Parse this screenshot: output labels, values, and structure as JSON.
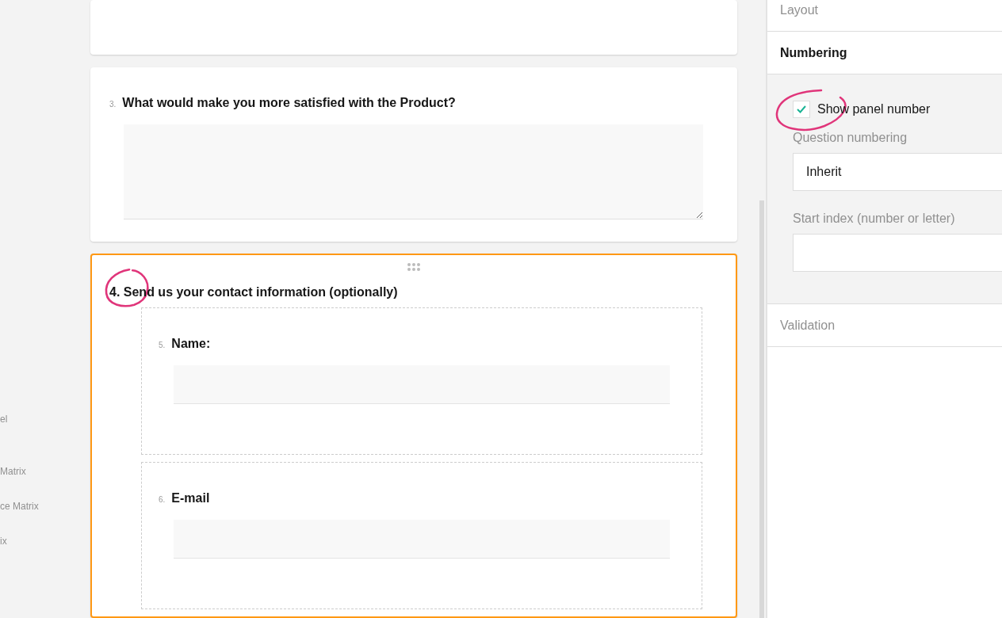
{
  "toolbox": {
    "items": [
      "el",
      "Matrix",
      "ce Matrix",
      "ix"
    ]
  },
  "survey": {
    "question": {
      "number": "3.",
      "title": "What would make you more satisfied with the Product?"
    },
    "panel": {
      "selected": true,
      "title": "4. Send us your contact information (optionally)",
      "questions": [
        {
          "number": "5.",
          "title": "Name:"
        },
        {
          "number": "6.",
          "title": "E-mail"
        }
      ]
    }
  },
  "properties": {
    "sections": [
      {
        "title": "Layout",
        "expanded": false
      },
      {
        "title": "Numbering",
        "expanded": true
      },
      {
        "title": "Validation",
        "expanded": false
      }
    ],
    "numbering": {
      "show_panel_number": {
        "label": "Show panel number",
        "checked": true
      },
      "question_numbering": {
        "label": "Question numbering",
        "value": "Inherit"
      },
      "start_index": {
        "label": "Start index (number or letter)"
      }
    }
  }
}
